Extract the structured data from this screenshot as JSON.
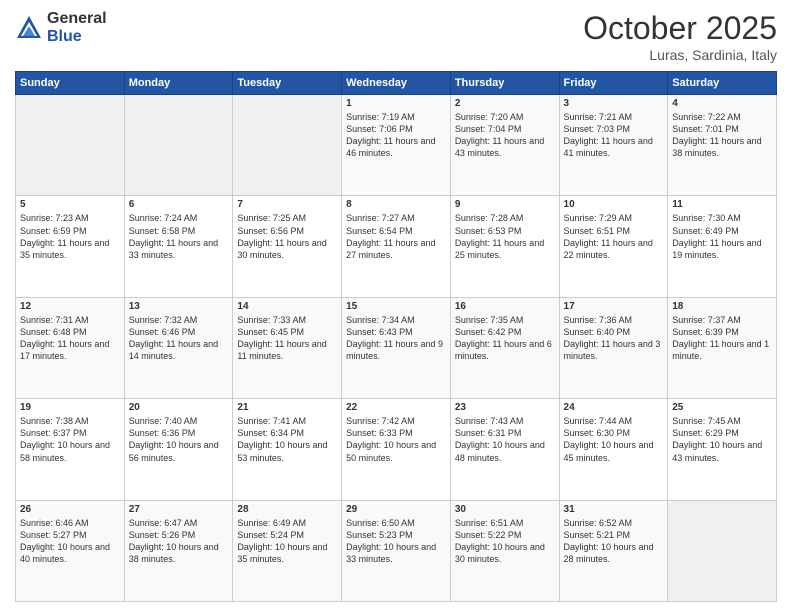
{
  "header": {
    "logo_general": "General",
    "logo_blue": "Blue",
    "month_title": "October 2025",
    "location": "Luras, Sardinia, Italy"
  },
  "weekdays": [
    "Sunday",
    "Monday",
    "Tuesday",
    "Wednesday",
    "Thursday",
    "Friday",
    "Saturday"
  ],
  "weeks": [
    [
      {
        "day": "",
        "empty": true
      },
      {
        "day": "",
        "empty": true
      },
      {
        "day": "",
        "empty": true
      },
      {
        "day": "1",
        "sunrise": "7:19 AM",
        "sunset": "7:06 PM",
        "daylight": "11 hours and 46 minutes."
      },
      {
        "day": "2",
        "sunrise": "7:20 AM",
        "sunset": "7:04 PM",
        "daylight": "11 hours and 43 minutes."
      },
      {
        "day": "3",
        "sunrise": "7:21 AM",
        "sunset": "7:03 PM",
        "daylight": "11 hours and 41 minutes."
      },
      {
        "day": "4",
        "sunrise": "7:22 AM",
        "sunset": "7:01 PM",
        "daylight": "11 hours and 38 minutes."
      }
    ],
    [
      {
        "day": "5",
        "sunrise": "7:23 AM",
        "sunset": "6:59 PM",
        "daylight": "11 hours and 35 minutes."
      },
      {
        "day": "6",
        "sunrise": "7:24 AM",
        "sunset": "6:58 PM",
        "daylight": "11 hours and 33 minutes."
      },
      {
        "day": "7",
        "sunrise": "7:25 AM",
        "sunset": "6:56 PM",
        "daylight": "11 hours and 30 minutes."
      },
      {
        "day": "8",
        "sunrise": "7:27 AM",
        "sunset": "6:54 PM",
        "daylight": "11 hours and 27 minutes."
      },
      {
        "day": "9",
        "sunrise": "7:28 AM",
        "sunset": "6:53 PM",
        "daylight": "11 hours and 25 minutes."
      },
      {
        "day": "10",
        "sunrise": "7:29 AM",
        "sunset": "6:51 PM",
        "daylight": "11 hours and 22 minutes."
      },
      {
        "day": "11",
        "sunrise": "7:30 AM",
        "sunset": "6:49 PM",
        "daylight": "11 hours and 19 minutes."
      }
    ],
    [
      {
        "day": "12",
        "sunrise": "7:31 AM",
        "sunset": "6:48 PM",
        "daylight": "11 hours and 17 minutes."
      },
      {
        "day": "13",
        "sunrise": "7:32 AM",
        "sunset": "6:46 PM",
        "daylight": "11 hours and 14 minutes."
      },
      {
        "day": "14",
        "sunrise": "7:33 AM",
        "sunset": "6:45 PM",
        "daylight": "11 hours and 11 minutes."
      },
      {
        "day": "15",
        "sunrise": "7:34 AM",
        "sunset": "6:43 PM",
        "daylight": "11 hours and 9 minutes."
      },
      {
        "day": "16",
        "sunrise": "7:35 AM",
        "sunset": "6:42 PM",
        "daylight": "11 hours and 6 minutes."
      },
      {
        "day": "17",
        "sunrise": "7:36 AM",
        "sunset": "6:40 PM",
        "daylight": "11 hours and 3 minutes."
      },
      {
        "day": "18",
        "sunrise": "7:37 AM",
        "sunset": "6:39 PM",
        "daylight": "11 hours and 1 minute."
      }
    ],
    [
      {
        "day": "19",
        "sunrise": "7:38 AM",
        "sunset": "6:37 PM",
        "daylight": "10 hours and 58 minutes."
      },
      {
        "day": "20",
        "sunrise": "7:40 AM",
        "sunset": "6:36 PM",
        "daylight": "10 hours and 56 minutes."
      },
      {
        "day": "21",
        "sunrise": "7:41 AM",
        "sunset": "6:34 PM",
        "daylight": "10 hours and 53 minutes."
      },
      {
        "day": "22",
        "sunrise": "7:42 AM",
        "sunset": "6:33 PM",
        "daylight": "10 hours and 50 minutes."
      },
      {
        "day": "23",
        "sunrise": "7:43 AM",
        "sunset": "6:31 PM",
        "daylight": "10 hours and 48 minutes."
      },
      {
        "day": "24",
        "sunrise": "7:44 AM",
        "sunset": "6:30 PM",
        "daylight": "10 hours and 45 minutes."
      },
      {
        "day": "25",
        "sunrise": "7:45 AM",
        "sunset": "6:29 PM",
        "daylight": "10 hours and 43 minutes."
      }
    ],
    [
      {
        "day": "26",
        "sunrise": "6:46 AM",
        "sunset": "5:27 PM",
        "daylight": "10 hours and 40 minutes."
      },
      {
        "day": "27",
        "sunrise": "6:47 AM",
        "sunset": "5:26 PM",
        "daylight": "10 hours and 38 minutes."
      },
      {
        "day": "28",
        "sunrise": "6:49 AM",
        "sunset": "5:24 PM",
        "daylight": "10 hours and 35 minutes."
      },
      {
        "day": "29",
        "sunrise": "6:50 AM",
        "sunset": "5:23 PM",
        "daylight": "10 hours and 33 minutes."
      },
      {
        "day": "30",
        "sunrise": "6:51 AM",
        "sunset": "5:22 PM",
        "daylight": "10 hours and 30 minutes."
      },
      {
        "day": "31",
        "sunrise": "6:52 AM",
        "sunset": "5:21 PM",
        "daylight": "10 hours and 28 minutes."
      },
      {
        "day": "",
        "empty": true
      }
    ]
  ]
}
